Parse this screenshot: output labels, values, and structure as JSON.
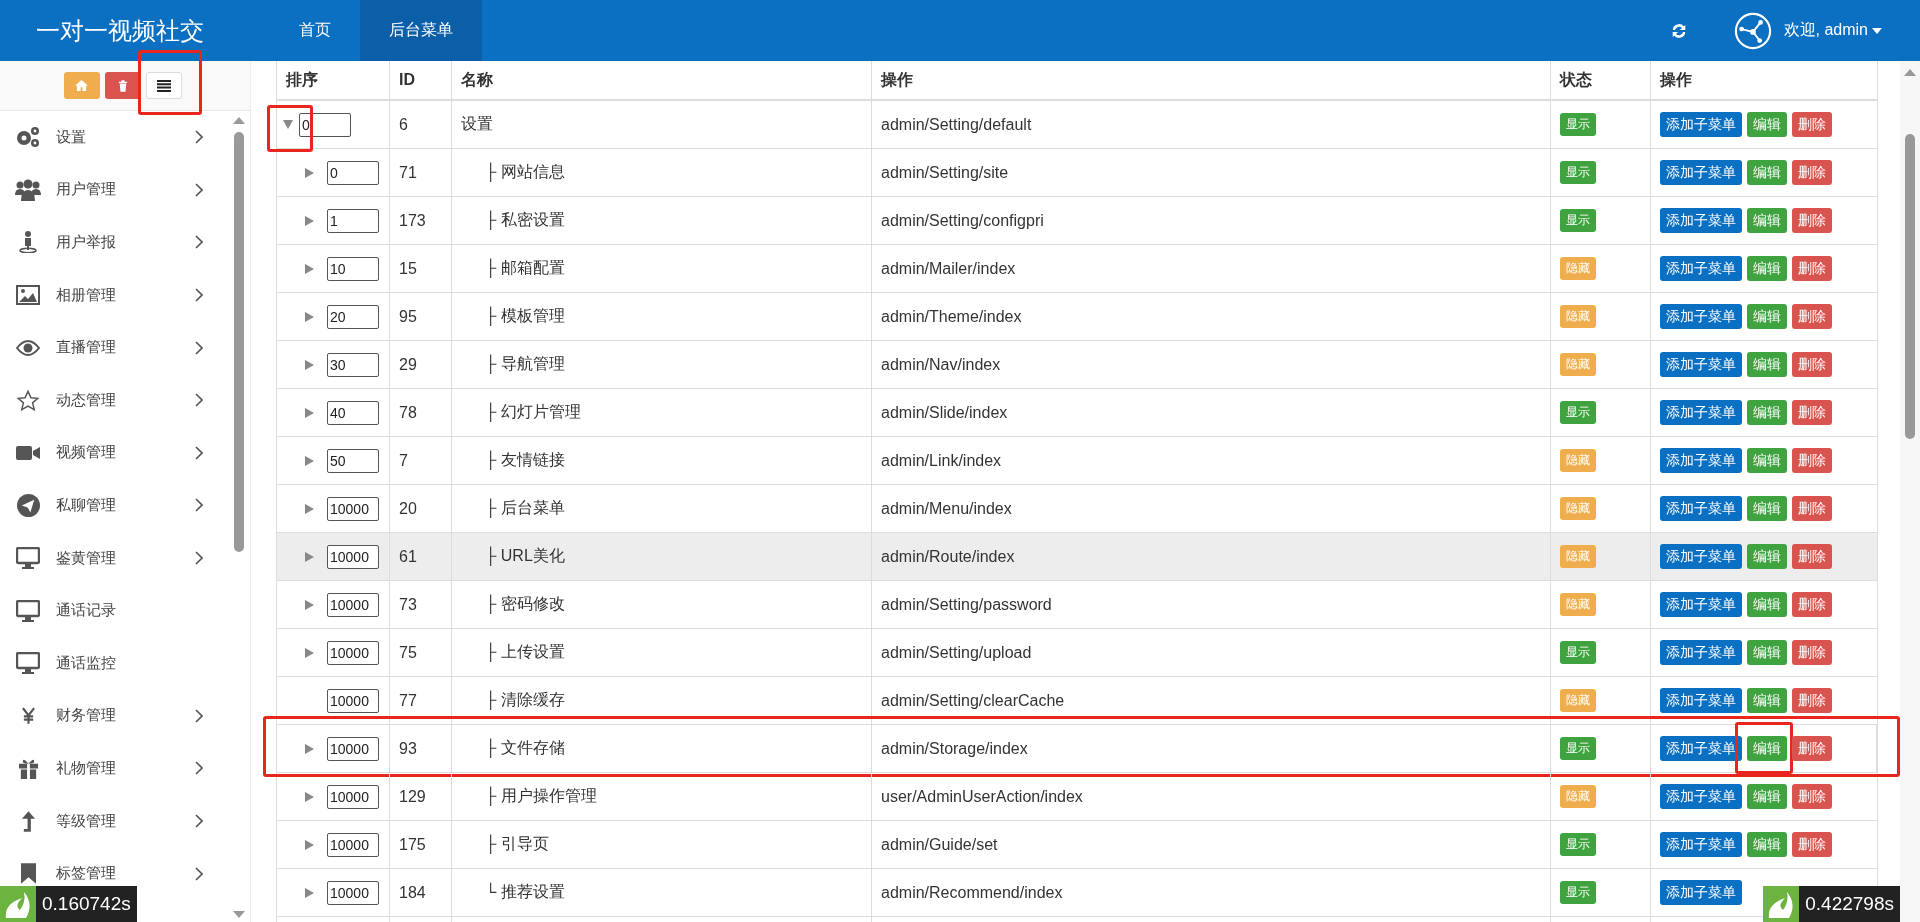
{
  "header": {
    "logo": "一对一视频社交",
    "nav": [
      {
        "label": "首页",
        "selected": false
      },
      {
        "label": "后台菜单",
        "selected": true
      }
    ],
    "user": "欢迎, admin"
  },
  "sidebar": {
    "tools": [
      {
        "highlighted": false
      },
      {
        "highlighted": false
      },
      {
        "highlighted": true
      }
    ],
    "items": [
      {
        "label": "设置",
        "has_children": true
      },
      {
        "label": "用户管理",
        "has_children": true
      },
      {
        "label": "用户举报",
        "has_children": true
      },
      {
        "label": "相册管理",
        "has_children": true
      },
      {
        "label": "直播管理",
        "has_children": true
      },
      {
        "label": "动态管理",
        "has_children": true
      },
      {
        "label": "视频管理",
        "has_children": true
      },
      {
        "label": "私聊管理",
        "has_children": true
      },
      {
        "label": "鉴黄管理",
        "has_children": true
      },
      {
        "label": "通话记录",
        "has_children": false
      },
      {
        "label": "通话监控",
        "has_children": false
      },
      {
        "label": "财务管理",
        "has_children": true
      },
      {
        "label": "礼物管理",
        "has_children": true
      },
      {
        "label": "等级管理",
        "has_children": true
      },
      {
        "label": "标签管理",
        "has_children": true
      }
    ]
  },
  "table": {
    "columns": [
      "排序",
      "ID",
      "名称",
      "操作",
      "状态",
      "操作"
    ],
    "rows": [
      {
        "order": "0",
        "id": "6",
        "name": "设置",
        "action": "admin/Setting/default",
        "status": "显示",
        "visible": true,
        "expanded": true,
        "hovered": false,
        "highlighted": false,
        "expander_highlighted": true,
        "edit_highlighted": false,
        "actions": [
          "添加子菜单",
          "编辑",
          "删除"
        ],
        "children": [
          {
            "order": "0",
            "id": "71",
            "name": "├ 网站信息",
            "action": "admin/Setting/site",
            "status": "显示",
            "visible": true,
            "has_children": true,
            "hovered": false,
            "highlighted": false,
            "expander_highlighted": false,
            "edit_highlighted": false,
            "actions": [
              "添加子菜单",
              "编辑",
              "删除"
            ]
          },
          {
            "order": "1",
            "id": "173",
            "name": "├ 私密设置",
            "action": "admin/Setting/configpri",
            "status": "显示",
            "visible": true,
            "has_children": true,
            "hovered": false,
            "highlighted": false,
            "expander_highlighted": false,
            "edit_highlighted": false,
            "actions": [
              "添加子菜单",
              "编辑",
              "删除"
            ]
          },
          {
            "order": "10",
            "id": "15",
            "name": "├ 邮箱配置",
            "action": "admin/Mailer/index",
            "status": "隐藏",
            "visible": false,
            "has_children": true,
            "hovered": false,
            "highlighted": false,
            "expander_highlighted": false,
            "edit_highlighted": false,
            "actions": [
              "添加子菜单",
              "编辑",
              "删除"
            ]
          },
          {
            "order": "20",
            "id": "95",
            "name": "├ 模板管理",
            "action": "admin/Theme/index",
            "status": "隐藏",
            "visible": false,
            "has_children": true,
            "hovered": false,
            "highlighted": false,
            "expander_highlighted": false,
            "edit_highlighted": false,
            "actions": [
              "添加子菜单",
              "编辑",
              "删除"
            ]
          },
          {
            "order": "30",
            "id": "29",
            "name": "├ 导航管理",
            "action": "admin/Nav/index",
            "status": "隐藏",
            "visible": false,
            "has_children": true,
            "hovered": false,
            "highlighted": false,
            "expander_highlighted": false,
            "edit_highlighted": false,
            "actions": [
              "添加子菜单",
              "编辑",
              "删除"
            ]
          },
          {
            "order": "40",
            "id": "78",
            "name": "├ 幻灯片管理",
            "action": "admin/Slide/index",
            "status": "显示",
            "visible": true,
            "has_children": true,
            "hovered": false,
            "highlighted": false,
            "expander_highlighted": false,
            "edit_highlighted": false,
            "actions": [
              "添加子菜单",
              "编辑",
              "删除"
            ]
          },
          {
            "order": "50",
            "id": "7",
            "name": "├ 友情链接",
            "action": "admin/Link/index",
            "status": "隐藏",
            "visible": false,
            "has_children": true,
            "hovered": false,
            "highlighted": false,
            "expander_highlighted": false,
            "edit_highlighted": false,
            "actions": [
              "添加子菜单",
              "编辑",
              "删除"
            ]
          },
          {
            "order": "10000",
            "id": "20",
            "name": "├ 后台菜单",
            "action": "admin/Menu/index",
            "status": "隐藏",
            "visible": false,
            "has_children": true,
            "hovered": false,
            "highlighted": false,
            "expander_highlighted": false,
            "edit_highlighted": false,
            "actions": [
              "添加子菜单",
              "编辑",
              "删除"
            ]
          },
          {
            "order": "10000",
            "id": "61",
            "name": "├ URL美化",
            "action": "admin/Route/index",
            "status": "隐藏",
            "visible": false,
            "has_children": true,
            "hovered": true,
            "highlighted": false,
            "expander_highlighted": false,
            "edit_highlighted": false,
            "actions": [
              "添加子菜单",
              "编辑",
              "删除"
            ]
          },
          {
            "order": "10000",
            "id": "73",
            "name": "├ 密码修改",
            "action": "admin/Setting/password",
            "status": "隐藏",
            "visible": false,
            "has_children": true,
            "hovered": false,
            "highlighted": false,
            "expander_highlighted": false,
            "edit_highlighted": false,
            "actions": [
              "添加子菜单",
              "编辑",
              "删除"
            ]
          },
          {
            "order": "10000",
            "id": "75",
            "name": "├ 上传设置",
            "action": "admin/Setting/upload",
            "status": "显示",
            "visible": true,
            "has_children": true,
            "hovered": false,
            "highlighted": false,
            "expander_highlighted": false,
            "edit_highlighted": false,
            "actions": [
              "添加子菜单",
              "编辑",
              "删除"
            ]
          },
          {
            "order": "10000",
            "id": "77",
            "name": "├ 清除缓存",
            "action": "admin/Setting/clearCache",
            "status": "隐藏",
            "visible": false,
            "has_children": false,
            "hovered": false,
            "highlighted": false,
            "expander_highlighted": false,
            "edit_highlighted": false,
            "actions": [
              "添加子菜单",
              "编辑",
              "删除"
            ]
          },
          {
            "order": "10000",
            "id": "93",
            "name": "├ 文件存储",
            "action": "admin/Storage/index",
            "status": "显示",
            "visible": true,
            "has_children": true,
            "hovered": false,
            "highlighted": true,
            "expander_highlighted": false,
            "edit_highlighted": true,
            "actions": [
              "添加子菜单",
              "编辑",
              "删除"
            ]
          },
          {
            "order": "10000",
            "id": "129",
            "name": "├ 用户操作管理",
            "action": "user/AdminUserAction/index",
            "status": "隐藏",
            "visible": false,
            "has_children": true,
            "hovered": false,
            "highlighted": false,
            "expander_highlighted": false,
            "edit_highlighted": false,
            "actions": [
              "添加子菜单",
              "编辑",
              "删除"
            ]
          },
          {
            "order": "10000",
            "id": "175",
            "name": "├ 引导页",
            "action": "admin/Guide/set",
            "status": "显示",
            "visible": true,
            "has_children": true,
            "hovered": false,
            "highlighted": false,
            "expander_highlighted": false,
            "edit_highlighted": false,
            "actions": [
              "添加子菜单",
              "编辑",
              "删除"
            ]
          },
          {
            "order": "10000",
            "id": "184",
            "name": "└ 推荐设置",
            "action": "admin/Recommend/index",
            "status": "显示",
            "visible": true,
            "has_children": true,
            "hovered": false,
            "highlighted": false,
            "expander_highlighted": false,
            "actions": [
              "添加子菜单"
            ]
          }
        ]
      }
    ]
  },
  "timers": [
    "0.160742s",
    "0.422798s"
  ]
}
